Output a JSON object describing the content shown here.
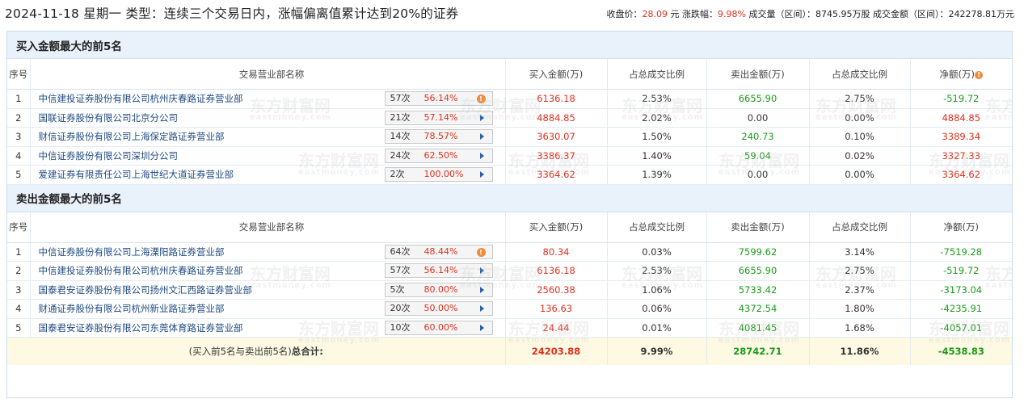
{
  "header": {
    "date": "2024-11-18",
    "weekday": "星期一",
    "type_label": "类型：",
    "type_text": "连续三个交易日内，涨幅偏离值累计达到20%的证券",
    "close_label": "收盘价：",
    "close_value": "28.09",
    "close_unit": "元",
    "change_label": "涨跌幅：",
    "change_value": "9.98%",
    "volume_label": "成交量（区间）：",
    "volume_value": "8745.95万股",
    "amount_label": "成交金额（区间）：",
    "amount_value": "242278.81万元"
  },
  "columns": {
    "idx": "序号",
    "name": "交易营业部名称",
    "buy": "买入金额(万)",
    "buy_ratio": "占总成交比例",
    "sell": "卖出金额(万)",
    "sell_ratio": "占总成交比例",
    "net": "净额(万)"
  },
  "buy_section": {
    "title": "买入金额最大的前5名",
    "rows": [
      {
        "idx": "1",
        "name": "中信建投证券股份有限公司杭州庆春路证券营业部",
        "count": "57次",
        "rate": "56.14%",
        "marker": "info-icon",
        "buy": "6136.18",
        "buy_ratio": "2.53%",
        "sell": "6655.90",
        "sell_ratio": "2.75%",
        "net": "-519.72"
      },
      {
        "idx": "2",
        "name": "国联证券股份有限公司北京分公司",
        "count": "21次",
        "rate": "57.14%",
        "marker": "arrow-right-icon",
        "buy": "4884.85",
        "buy_ratio": "2.02%",
        "sell": "0.00",
        "sell_ratio": "0.00%",
        "net": "4884.85"
      },
      {
        "idx": "3",
        "name": "财信证券股份有限公司上海保定路证券营业部",
        "count": "14次",
        "rate": "78.57%",
        "marker": "arrow-right-icon",
        "buy": "3630.07",
        "buy_ratio": "1.50%",
        "sell": "240.73",
        "sell_ratio": "0.10%",
        "net": "3389.34"
      },
      {
        "idx": "4",
        "name": "中信证券股份有限公司深圳分公司",
        "count": "24次",
        "rate": "62.50%",
        "marker": "arrow-right-icon",
        "buy": "3386.37",
        "buy_ratio": "1.40%",
        "sell": "59.04",
        "sell_ratio": "0.02%",
        "net": "3327.33"
      },
      {
        "idx": "5",
        "name": "爱建证券有限责任公司上海世纪大道证券营业部",
        "count": "2次",
        "rate": "100.00%",
        "marker": "arrow-right-icon",
        "buy": "3364.62",
        "buy_ratio": "1.39%",
        "sell": "0.00",
        "sell_ratio": "0.00%",
        "net": "3364.62"
      }
    ]
  },
  "sell_section": {
    "title": "卖出金额最大的前5名",
    "rows": [
      {
        "idx": "1",
        "name": "中信证券股份有限公司上海溧阳路证券营业部",
        "count": "64次",
        "rate": "48.44%",
        "marker": "info-icon",
        "buy": "80.34",
        "buy_ratio": "0.03%",
        "sell": "7599.62",
        "sell_ratio": "3.14%",
        "net": "-7519.28"
      },
      {
        "idx": "2",
        "name": "中信建投证券股份有限公司杭州庆春路证券营业部",
        "count": "57次",
        "rate": "56.14%",
        "marker": "arrow-right-icon",
        "buy": "6136.18",
        "buy_ratio": "2.53%",
        "sell": "6655.90",
        "sell_ratio": "2.75%",
        "net": "-519.72"
      },
      {
        "idx": "3",
        "name": "国泰君安证券股份有限公司扬州文汇西路证券营业部",
        "count": "5次",
        "rate": "80.00%",
        "marker": "arrow-right-icon",
        "buy": "2560.38",
        "buy_ratio": "1.06%",
        "sell": "5733.42",
        "sell_ratio": "2.37%",
        "net": "-3173.04"
      },
      {
        "idx": "4",
        "name": "财通证券股份有限公司杭州新业路证券营业部",
        "count": "20次",
        "rate": "50.00%",
        "marker": "arrow-right-icon",
        "buy": "136.63",
        "buy_ratio": "0.06%",
        "sell": "4372.54",
        "sell_ratio": "1.80%",
        "net": "-4235.91"
      },
      {
        "idx": "5",
        "name": "国泰君安证券股份有限公司东莞体育路证券营业部",
        "count": "10次",
        "rate": "60.00%",
        "marker": "arrow-right-icon",
        "buy": "24.44",
        "buy_ratio": "0.01%",
        "sell": "4081.45",
        "sell_ratio": "1.68%",
        "net": "-4057.01"
      }
    ]
  },
  "total": {
    "label_prefix": "(买入前5名与卖出前5名)",
    "label_bold": "总合计:",
    "buy": "24203.88",
    "buy_ratio": "9.99%",
    "sell": "28742.71",
    "sell_ratio": "11.86%",
    "net": "-4538.83"
  },
  "watermark": {
    "cn": "东方财富网",
    "en": "eastmoney.com"
  },
  "colors": {
    "up": "#e0301e",
    "down": "#1a9b1a",
    "link": "#1f4a82",
    "section_bg": "#e9f1fb",
    "total_bg": "#fdf9e3"
  }
}
